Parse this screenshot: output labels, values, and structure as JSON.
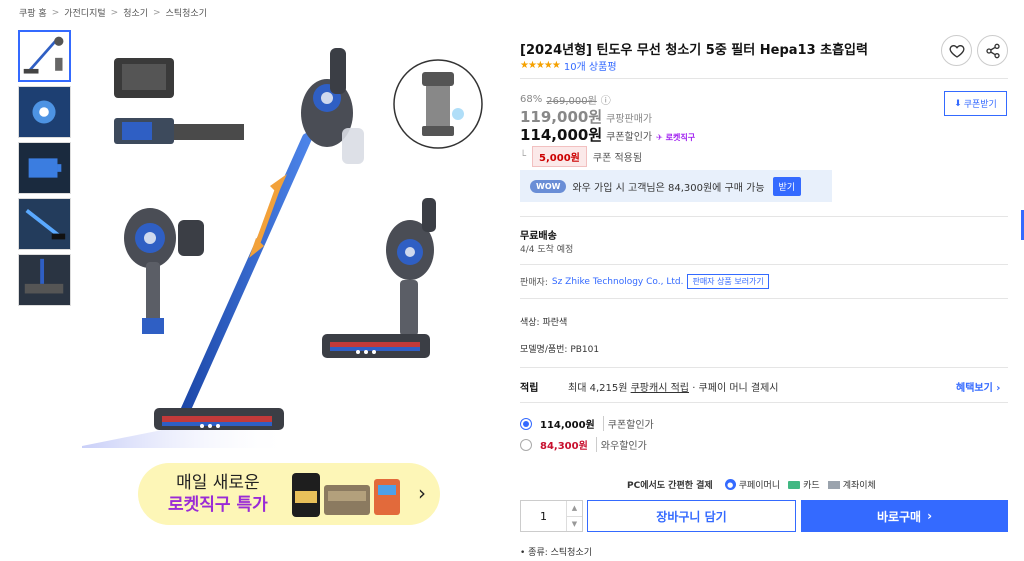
{
  "breadcrumb": [
    "쿠팡 홈",
    "가전디지털",
    "청소기",
    "스틱청소기"
  ],
  "breadcrumb_sep": ">",
  "product": {
    "title": "[2024년형] 틴도우 무선 청소기 5중 필터 Hepa13 초흡입력",
    "stars": "★★★★★",
    "review_count": "10개 상품평"
  },
  "price": {
    "discount_rate": "68%",
    "original_price": "269,000원",
    "info_icon": "ⓘ",
    "sale_price": "119,000원",
    "sale_label": "쿠팡판매가",
    "coupon_price": "114,000원",
    "coupon_label": "쿠폰할인가",
    "rocket_badge": "로켓직구",
    "coupon_amount": "5,000원",
    "coupon_applied": "쿠폰 적용됨",
    "coupon_button": "쿠폰받기"
  },
  "wow": {
    "badge": "WOW",
    "text": "와우 가입 시 고객님은 84,300원에 구매 가능",
    "button": "받기"
  },
  "shipping": {
    "title": "무료배송",
    "eta": "4/4 도착 예정"
  },
  "seller": {
    "label": "판매자:",
    "name": "Sz Zhike Technology Co., Ltd.",
    "button": "판매자 상품 보러가기"
  },
  "options": {
    "color": "색상: 파란색",
    "model": "모델명/품번: PB101"
  },
  "points": {
    "label": "적립",
    "text_prefix": "최대 4,215원",
    "text_link": "쿠팡캐시 적립",
    "text_suffix": "· 쿠페이 머니 결제시",
    "link": "혜택보기 ›"
  },
  "price_options": [
    {
      "value": "114,000원",
      "label": "쿠폰할인가",
      "selected": true
    },
    {
      "value": "84,300원",
      "label": "와우할인가",
      "selected": false
    }
  ],
  "payment": {
    "title": "PC에서도 간편한 결제",
    "coupay": "쿠페이머니",
    "card": "카드",
    "bank": "계좌이체"
  },
  "purchase": {
    "quantity": "1",
    "cart_button": "장바구니 담기",
    "buy_button": "바로구매",
    "buy_arrow": "›"
  },
  "specs": [
    "종류: 스틱청소기"
  ],
  "promo": {
    "line1": "매일 새로운",
    "line2": "로켓직구 특가",
    "arrow": "›"
  },
  "colors": {
    "accent": "#346aff",
    "rocket": "#9a2bd6",
    "coupon_red": "#c8102e",
    "vacuum_blue": "#2f5fc4"
  }
}
